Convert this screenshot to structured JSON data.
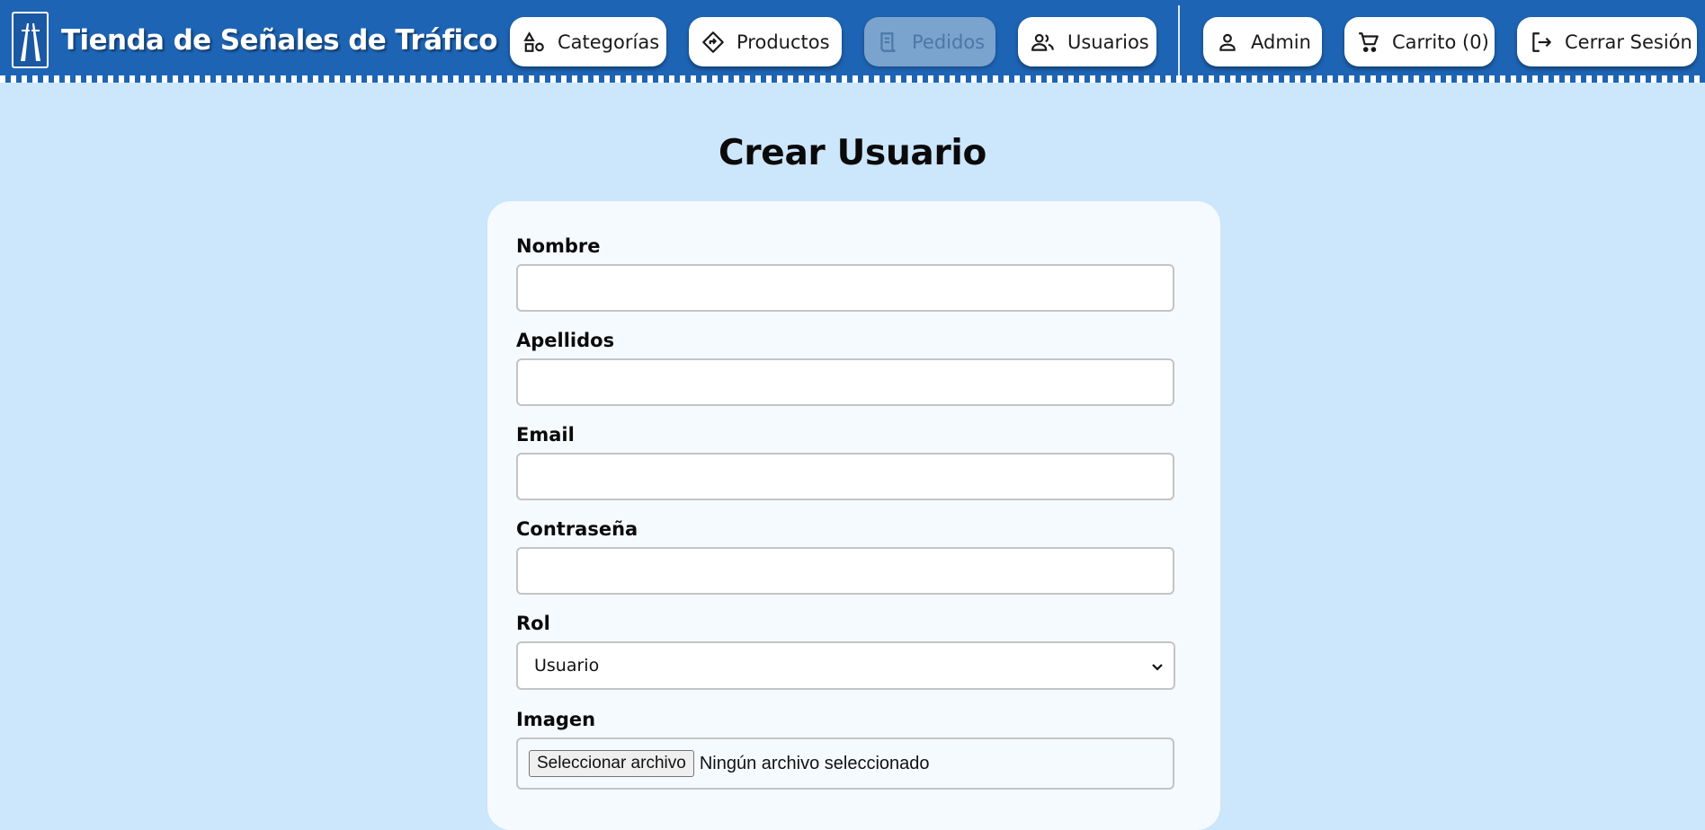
{
  "header": {
    "brand_title": "Tienda de Señales de Tráfico",
    "nav": {
      "categorias": "Categorías",
      "productos": "Productos",
      "pedidos": "Pedidos",
      "usuarios": "Usuarios",
      "admin": "Admin",
      "carrito": "Carrito (0)",
      "cerrar_sesion": "Cerrar Sesión"
    },
    "icons": {
      "categorias": "shapes-icon",
      "productos": "road-sign-icon",
      "pedidos": "receipt-icon",
      "usuarios": "users-icon",
      "admin": "person-icon",
      "carrito": "cart-icon",
      "cerrar_sesion": "logout-icon"
    }
  },
  "page": {
    "title": "Crear Usuario"
  },
  "form": {
    "nombre": {
      "label": "Nombre",
      "value": ""
    },
    "apellidos": {
      "label": "Apellidos",
      "value": ""
    },
    "email": {
      "label": "Email",
      "value": ""
    },
    "password": {
      "label": "Contraseña",
      "value": ""
    },
    "rol": {
      "label": "Rol",
      "selected": "Usuario"
    },
    "imagen": {
      "label": "Imagen",
      "button": "Seleccionar archivo",
      "status": "Ningún archivo seleccionado"
    }
  },
  "colors": {
    "navbar": "#1e64b4",
    "page_background": "#cce6fb",
    "card_background": "#f5faff",
    "disabled_button": "#7aa3cd"
  }
}
